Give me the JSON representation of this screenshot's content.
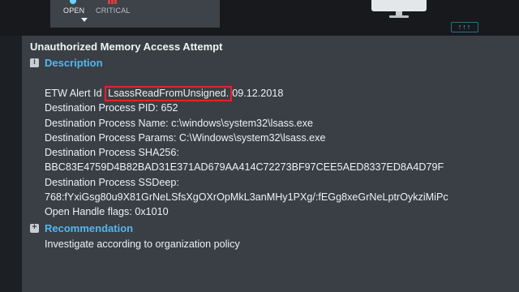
{
  "toolbar": {
    "open_label": "OPEN",
    "critical_label": "CRITICAL",
    "expand_label": "↑↑↑"
  },
  "colors": {
    "accent": "#52b7ef",
    "critical": "#e23b3b",
    "highlight_box": "#e22525",
    "panel_bg": "#3a3f45"
  },
  "alert": {
    "title": "Unauthorized Memory Access Attempt",
    "description_heading": "Description",
    "etw_prefix": "ETW Alert Id ",
    "etw_highlight": "LsassReadFromUnsigned.",
    "etw_suffix": "09.12.2018",
    "lines": [
      "Destination Process PID: 652",
      "Destination Process Name: c:\\windows\\system32\\lsass.exe",
      "Destination Process Params: C:\\Windows\\system32\\lsass.exe",
      "Destination Process SHA256:",
      "BBC83E4759D4B82BAD31E371AD679AA414C72273BF97CEE5AED8337ED8A4D79F",
      "Destination Process SSDeep:",
      "768:fYxiGsg80u9X81GrNeLSfsXgOXrOpMkL3anMHy1PXg/:fEGg8xeGrNeLptrOykziMiPc",
      "Open Handle flags: 0x1010"
    ],
    "recommendation_heading": "Recommendation",
    "recommendation_text": "Investigate according to organization policy"
  },
  "icons": {
    "description": "info-icon",
    "recommendation": "comment-add-icon",
    "device": "monitor-icon"
  }
}
